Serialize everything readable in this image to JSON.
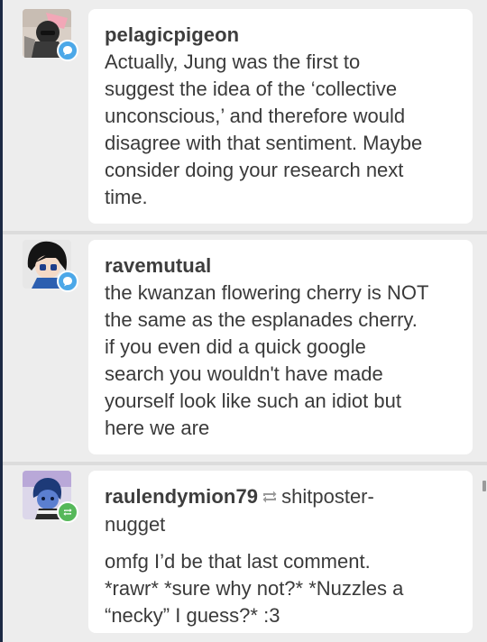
{
  "comments": [
    {
      "username": "pelagicpigeon",
      "badge": {
        "type": "reply",
        "color": "#4ca8e8",
        "icon": "speech-bubble-icon"
      },
      "lines": [
        "Actually, Jung was the first to",
        "suggest the idea of the ‘collective",
        "unconscious,’ and therefore would",
        "disagree with that sentiment. Maybe",
        "consider doing your research next",
        "time."
      ]
    },
    {
      "username": "ravemutual",
      "badge": {
        "type": "reply",
        "color": "#4ca8e8",
        "icon": "speech-bubble-icon"
      },
      "lines": [
        "the kwanzan flowering cherry is NOT",
        "the same as the esplanades cherry.",
        "if you even did a quick google",
        "search you wouldn't have made",
        "yourself look like such an idiot but",
        "here we are"
      ]
    },
    {
      "username": "raulendymion79",
      "reblogged_from_part1": "shitposter-",
      "reblogged_from_part2": "nugget",
      "badge": {
        "type": "reblog",
        "color": "#56b85a",
        "icon": "reblog-icon"
      },
      "lines": [
        "omfg I’d be that last comment.",
        "*rawr* *sure why not?* *Nuzzles a",
        "“necky” I guess?* :3"
      ]
    }
  ]
}
